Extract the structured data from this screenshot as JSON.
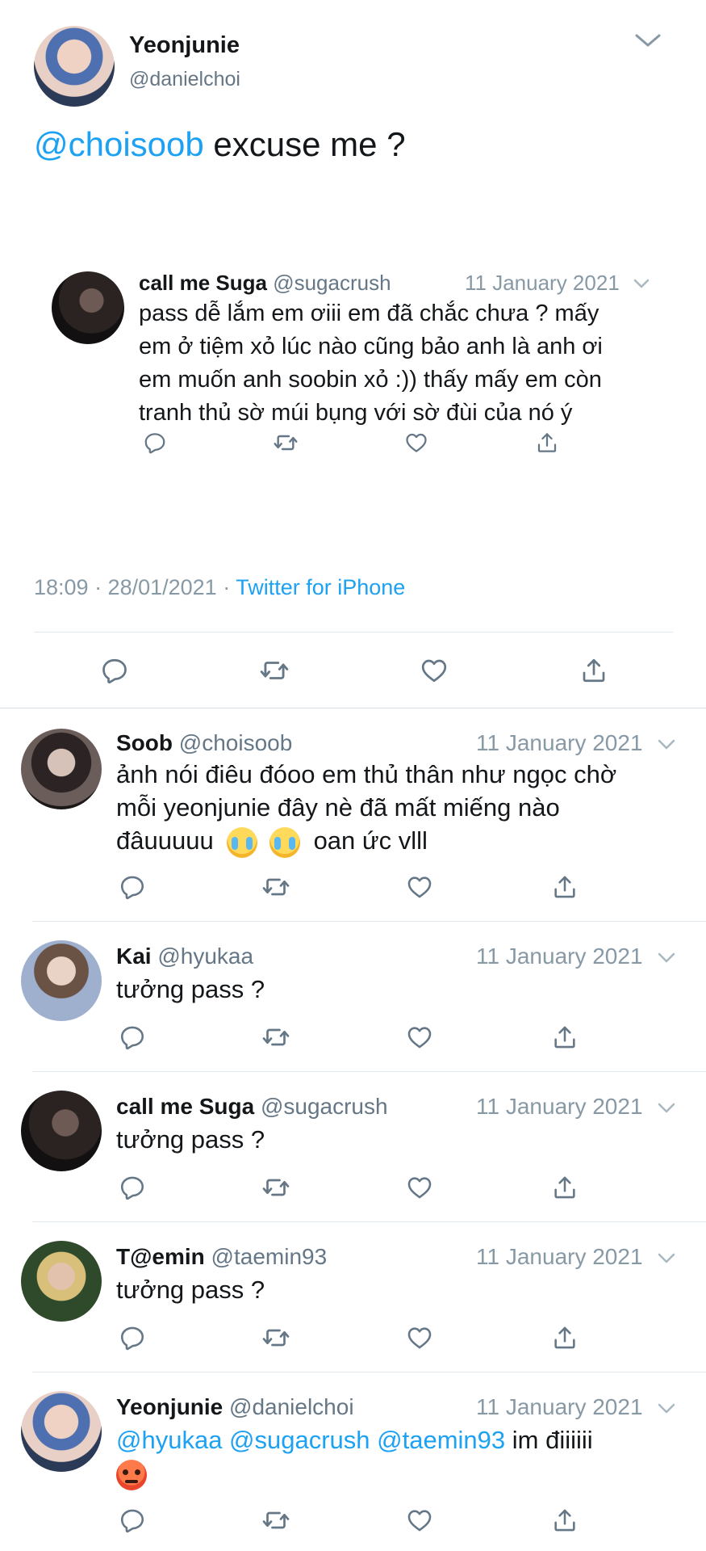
{
  "main_tweet": {
    "name": "Yeonjunie",
    "handle": "@danielchoi",
    "mention": "@choisoob",
    "text": " excuse me ?",
    "time": "18:09 · 28/01/2021 · ",
    "source": "Twitter for iPhone"
  },
  "quoted": {
    "name": "call me Suga",
    "handle": "@sugacrush",
    "date": "11 January 2021",
    "lines": [
      "pass dễ lắm em ơiii em đã chắc chưa ? mấy",
      "em ở tiệm xỏ lúc nào cũng bảo anh là anh ơi",
      "em muốn anh soobin xỏ :)) thấy mấy em còn",
      "tranh thủ sờ múi bụng với sờ đùi của nó ý"
    ]
  },
  "replies": [
    {
      "name": "Soob",
      "handle": "@choisoob",
      "date": "11 January 2021",
      "lines": [
        "ảnh nói điêu đóoo em thủ thân như ngọc chờ",
        "mỗi yeonjunie đây nè đã mất miếng nào",
        "đâuuuuu",
        "oan ức vlll"
      ]
    },
    {
      "name": "Kai",
      "handle": "@hyukaa",
      "date": "11 January 2021",
      "text": "tưởng pass ?"
    },
    {
      "name": "call me Suga",
      "handle": "@sugacrush",
      "date": "11 January 2021",
      "text": "tưởng pass ?"
    },
    {
      "name": "T@emin",
      "handle": "@taemin93",
      "date": "11 January 2021",
      "text": "tưởng pass ?"
    },
    {
      "name": "Yeonjunie",
      "handle": "@danielchoi",
      "date": "11 January 2021",
      "mentions": "@hyukaa @sugacrush @taemin93",
      "text": " im điiiiii"
    }
  ],
  "colors": {
    "accent": "#1da1f2",
    "icon": "#657786",
    "divider": "#e1e8ed"
  },
  "icons": [
    "reply-icon",
    "retweet-icon",
    "like-icon",
    "share-icon",
    "chevron-down-icon"
  ]
}
